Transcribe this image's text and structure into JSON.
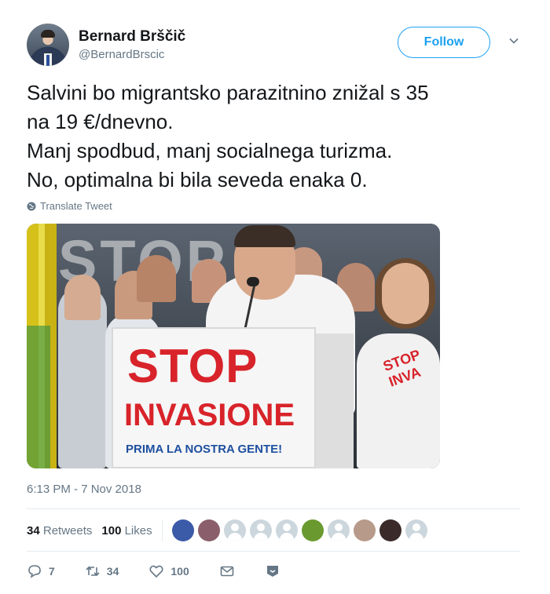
{
  "user": {
    "name": "Bernard Brščič",
    "handle": "@BernardBrscic",
    "avatar_icon": "profile-photo"
  },
  "follow_label": "Follow",
  "tweet": {
    "lines": [
      "Salvini bo migrantsko parazitnino znižal s 35",
      "na 19 €/dnevno.",
      "Manj spodbud, manj socialnega turizma.",
      "No, optimalna bi bila seveda enaka 0."
    ],
    "translate_label": "Translate Tweet"
  },
  "media": {
    "sign_line1": "STOP",
    "sign_line2": "INVASIONE",
    "sign_line3": "PRIMA LA NOSTRA GENTE!",
    "banner_partial": "STOP",
    "shirt_text": "STOP INVA"
  },
  "timestamp": "6:13 PM - 7 Nov 2018",
  "stats": {
    "retweets_count": "34",
    "retweets_label": "Retweets",
    "likes_count": "100",
    "likes_label": "Likes"
  },
  "likers": [
    {
      "icon": "flag-avatar",
      "color": "#3b5aa8"
    },
    {
      "icon": "photo-avatar",
      "color": "#8a5e6a"
    },
    {
      "icon": "default-avatar",
      "color": "#ccd6dd"
    },
    {
      "icon": "default-avatar",
      "color": "#ccd6dd"
    },
    {
      "icon": "default-avatar",
      "color": "#ccd6dd"
    },
    {
      "icon": "ball-avatar",
      "color": "#6a9a2f"
    },
    {
      "icon": "default-avatar",
      "color": "#ccd6dd"
    },
    {
      "icon": "pattern-avatar",
      "color": "#b79a8a"
    },
    {
      "icon": "photo-avatar",
      "color": "#3a2a2a"
    },
    {
      "icon": "default-avatar",
      "color": "#ccd6dd"
    }
  ],
  "actions": {
    "reply_count": "7",
    "retweet_count": "34",
    "like_count": "100"
  },
  "colors": {
    "accent": "#1da1f2",
    "secondary_text": "#657786",
    "sign_red": "#d8232a",
    "sign_blue": "#1e4f9f"
  }
}
